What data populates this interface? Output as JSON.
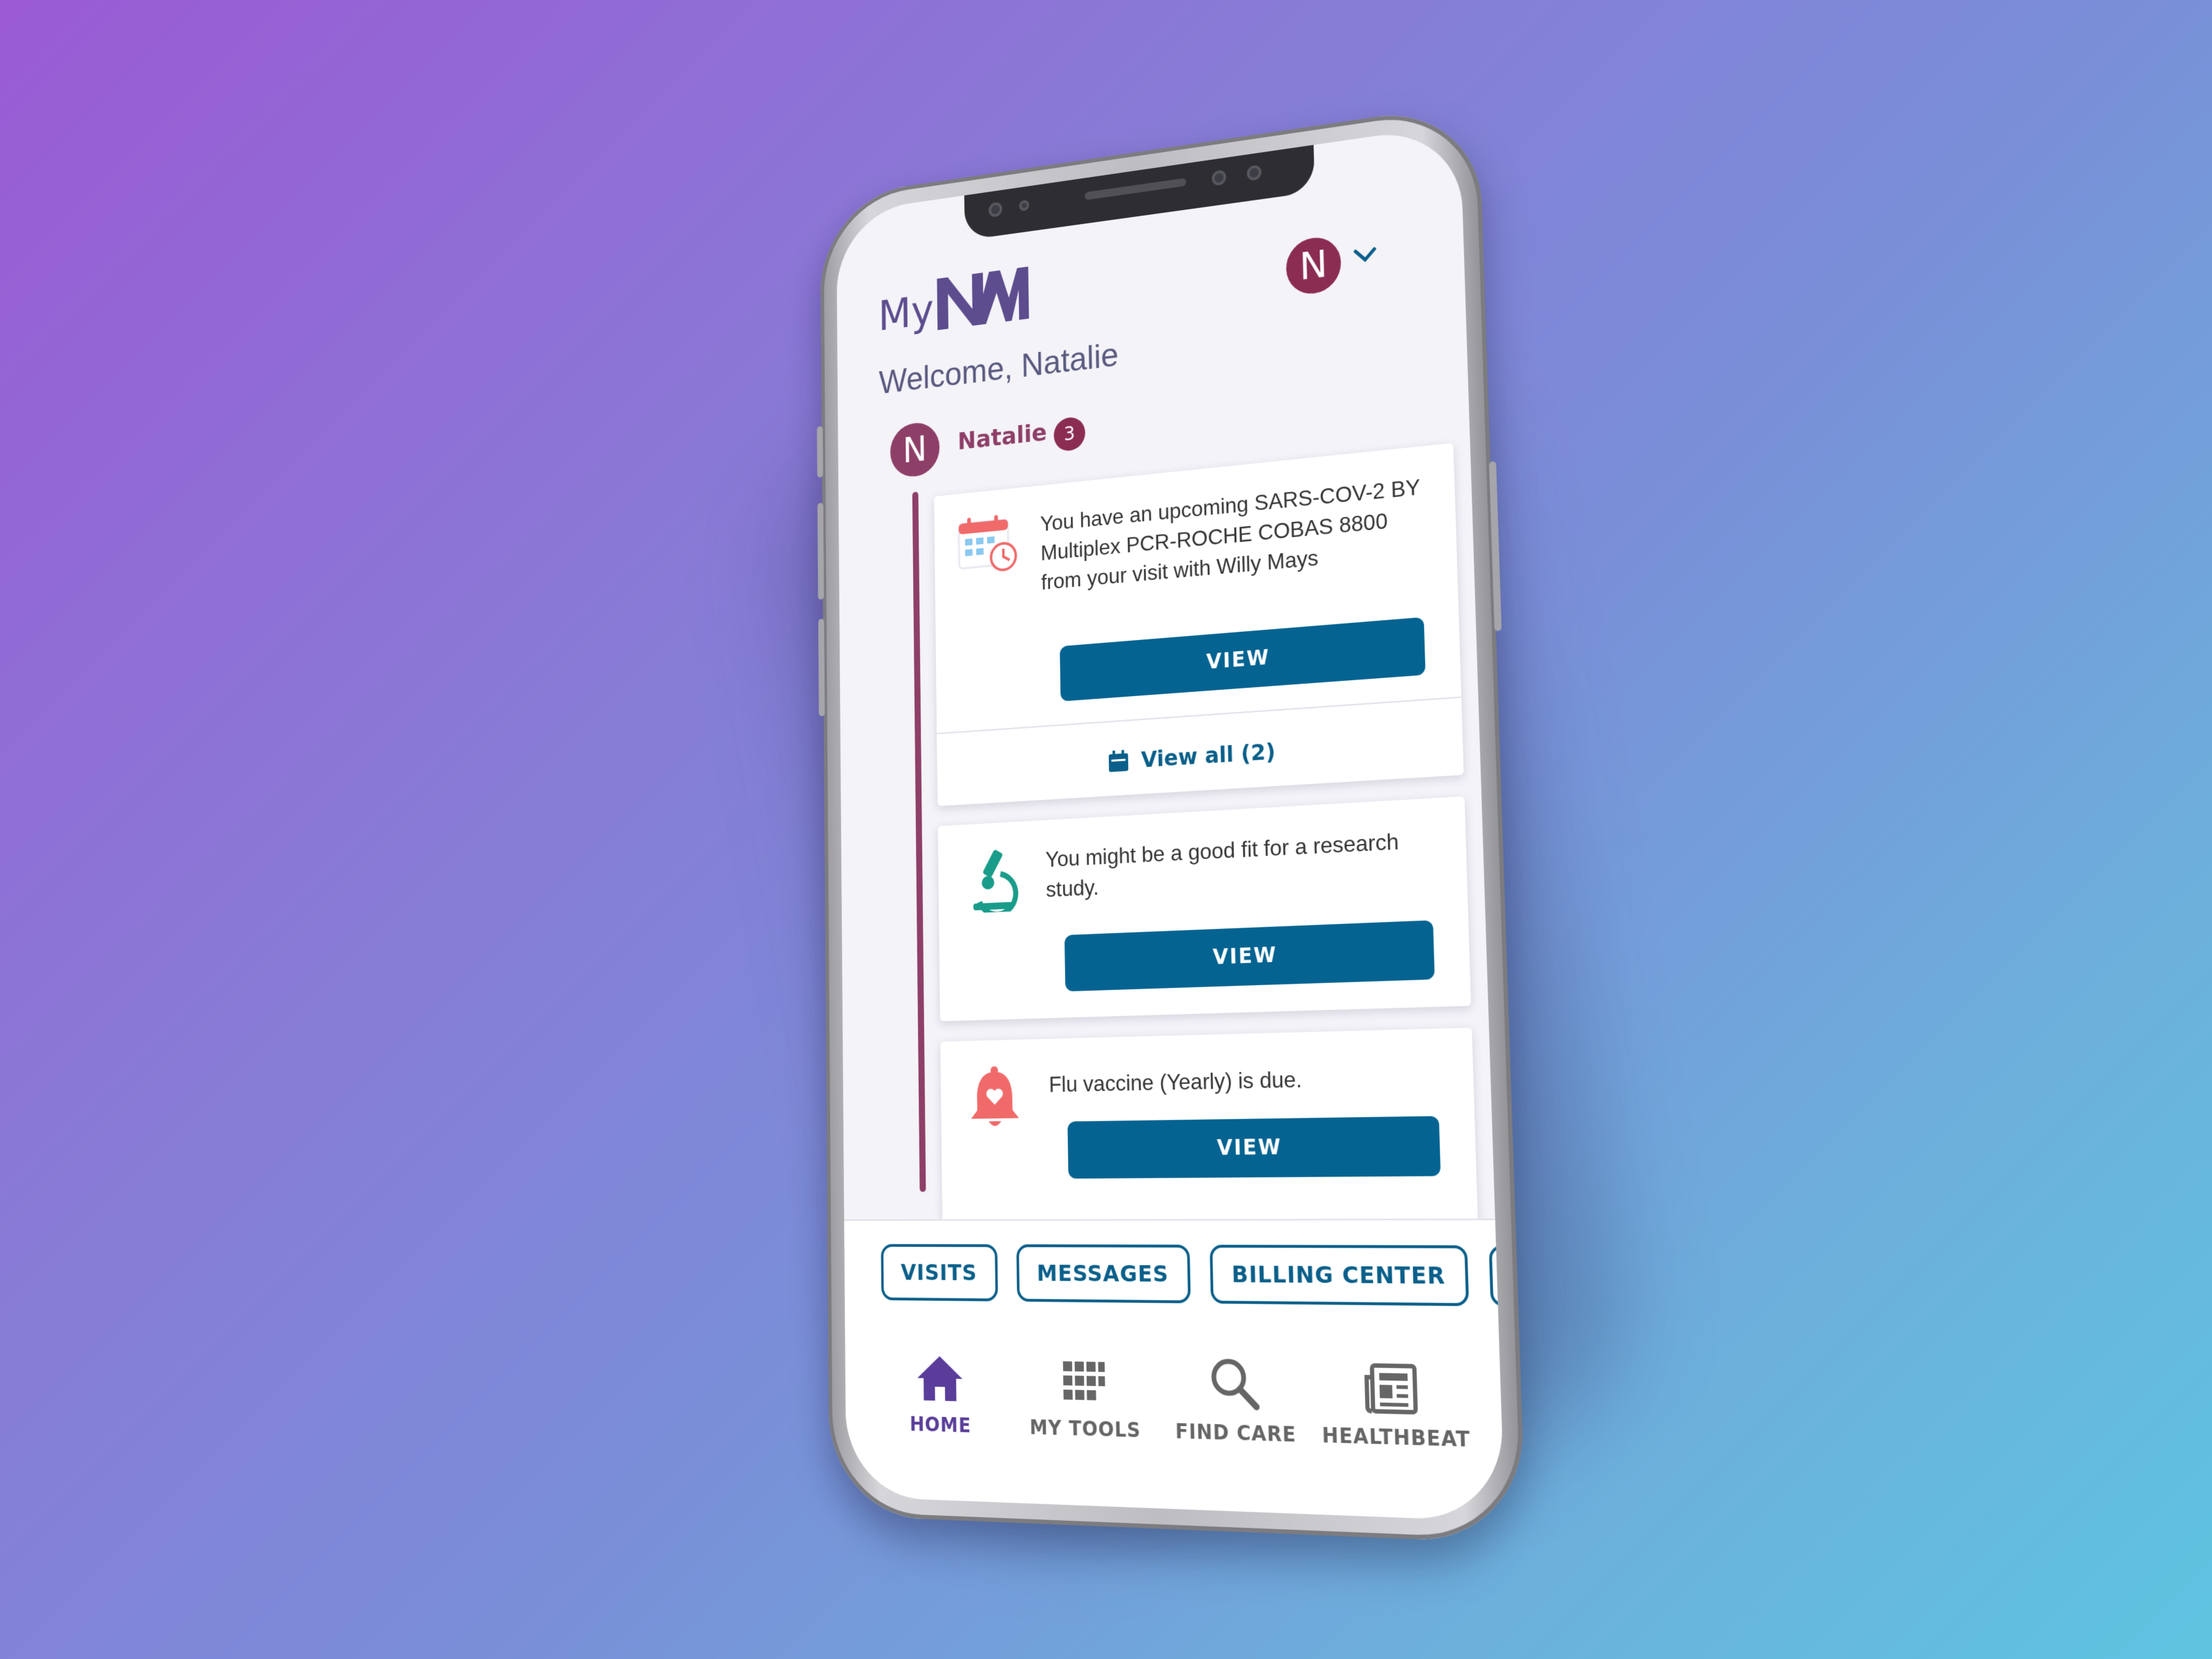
{
  "app": {
    "logo_text": "My",
    "logo_mark": "NM",
    "user_initial": "N"
  },
  "welcome": "Welcome, Natalie",
  "person": {
    "initial": "N",
    "name": "Natalie",
    "badge": "3"
  },
  "cards": [
    {
      "icon": "calendar-clock-icon",
      "text": "You have an upcoming SARS-COV-2 BY Multiplex PCR-ROCHE COBAS 8800 from your visit with Willy Mays",
      "button": "VIEW",
      "view_all": "View all (2)"
    },
    {
      "icon": "microscope-icon",
      "text": "You might be a good fit for a research study.",
      "button": "VIEW"
    },
    {
      "icon": "bell-heart-icon",
      "text": "Flu vaccine (Yearly) is due.",
      "button": "VIEW"
    }
  ],
  "quicklinks": [
    "VISITS",
    "MESSAGES",
    "BILLING CENTER"
  ],
  "tabs": [
    {
      "label": "HOME",
      "icon": "home-icon",
      "active": true
    },
    {
      "label": "MY TOOLS",
      "icon": "grid-icon",
      "active": false
    },
    {
      "label": "FIND CARE",
      "icon": "search-icon",
      "active": false
    },
    {
      "label": "HEALTHBEAT",
      "icon": "newspaper-icon",
      "active": false
    }
  ],
  "colors": {
    "brand_purple": "#5d4d8e",
    "accent_maroon": "#8e3f68",
    "button_blue": "#046391",
    "active_tab": "#5a3d9a"
  }
}
